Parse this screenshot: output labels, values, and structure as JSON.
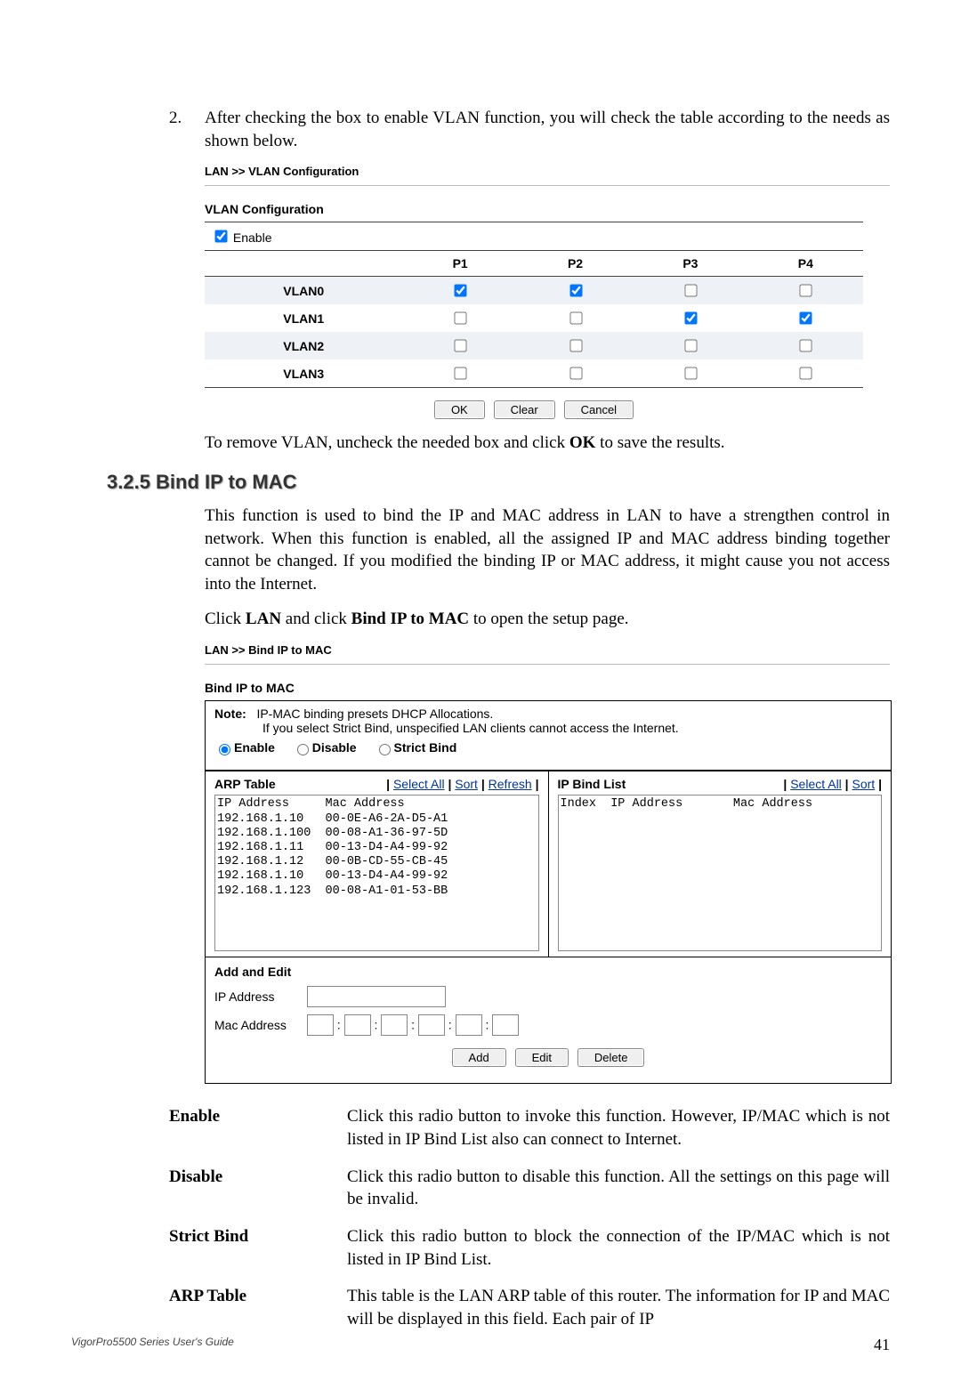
{
  "step": {
    "number": "2.",
    "text": "After checking the box to enable VLAN function, you will check the table according to the needs as shown below."
  },
  "vlan_shot": {
    "crumb": "LAN >> VLAN Configuration",
    "title": "VLAN Configuration",
    "enable_label": "Enable",
    "cols": [
      "P1",
      "P2",
      "P3",
      "P4"
    ],
    "rows": [
      "VLAN0",
      "VLAN1",
      "VLAN2",
      "VLAN3"
    ],
    "checks": [
      [
        true,
        true,
        false,
        false
      ],
      [
        false,
        false,
        true,
        true
      ],
      [
        false,
        false,
        false,
        false
      ],
      [
        false,
        false,
        false,
        false
      ]
    ],
    "btn_ok": "OK",
    "btn_clear": "Clear",
    "btn_cancel": "Cancel"
  },
  "vlan_remove": "To remove VLAN, uncheck the needed box and click OK to save the results.",
  "section_title": "3.2.5 Bind IP to MAC",
  "bind_intro_1": "This function is used to bind the IP and MAC address in LAN to have a strengthen control in network. When this function is enabled, all the assigned IP and MAC address binding together cannot be changed. If you modified the binding IP or MAC address, it might cause you not access into the Internet.",
  "bind_intro_2": "Click LAN and click Bind IP to MAC to open the setup page.",
  "bind_shot": {
    "crumb": "LAN >> Bind IP to MAC",
    "title": "Bind IP to MAC",
    "note_label": "Note:",
    "note1": "IP-MAC binding presets DHCP Allocations.",
    "note2": "If you select Strict Bind, unspecified LAN clients cannot access the Internet.",
    "radios": {
      "enable": "Enable",
      "disable": "Disable",
      "strict": "Strict Bind"
    },
    "arp_title": "ARP Table",
    "arp_actions": "Select All | Sort | Refresh",
    "bind_title": "IP Bind List",
    "bind_actions": "Select All | Sort",
    "arp_header": "IP Address     Mac Address",
    "arp_rows": [
      "192.168.1.10   00-0E-A6-2A-D5-A1",
      "192.168.1.100  00-08-A1-36-97-5D",
      "192.168.1.11   00-13-D4-A4-99-92",
      "192.168.1.12   00-0B-CD-55-CB-45",
      "192.168.1.10   00-13-D4-A4-99-92",
      "192.168.1.123  00-08-A1-01-53-BB"
    ],
    "bind_header": "Index  IP Address       Mac Address",
    "addedit": "Add and Edit",
    "ip_label": "IP Address",
    "mac_label": "Mac Address",
    "btn_add": "Add",
    "btn_edit": "Edit",
    "btn_delete": "Delete"
  },
  "defs": [
    {
      "term": "Enable",
      "desc": "Click this radio button to invoke this function. However, IP/MAC which is not listed in IP Bind List also can connect to Internet."
    },
    {
      "term": "Disable",
      "desc": "Click this radio button to disable this function. All the settings on this page will be invalid."
    },
    {
      "term": "Strict Bind",
      "desc": "Click this radio button to block the connection of the IP/MAC which is not listed in IP Bind List."
    },
    {
      "term": "ARP Table",
      "desc": "This table is the LAN ARP table of this router. The information for IP and MAC will be displayed in this field. Each pair of IP"
    }
  ],
  "footer": {
    "guide": "VigorPro5500 Series User's Guide",
    "page": "41"
  }
}
